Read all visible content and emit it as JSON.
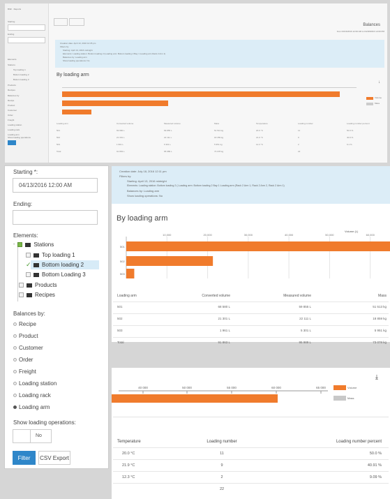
{
  "top": {
    "app_title": "ВЭК · Reports",
    "starting_label": "Starting",
    "starting_value": "04/13/2016 12:00 AM",
    "ending_label": "Ending",
    "back_label": "‹ Back",
    "report_title": "Balances",
    "report_subtitle": "from 04/13/2016 12:00 AM to 04/18/2016 12:00 PM",
    "info": {
      "line1": "Creation date: April 13, 2016 12:35 pm",
      "line2": "Filters by:",
      "items": [
        "Starting: April 13, 2016 midnight",
        "Elements: Loading station: Bottom loading 2 (Loading arm: Bottom loading 2 Bay 1 Loading arm Rack 2 Arm 1)",
        "Balances by: Loading arm",
        "Show loading operations: No"
      ]
    },
    "chart_title": "By loading arm",
    "legend": [
      "Volume",
      "Mass"
    ],
    "table_headers": [
      "Loading arm",
      "Converted volume",
      "Measured volume",
      "Mass",
      "Temperature",
      "Loading number",
      "Loading number percent"
    ],
    "table_rows": [
      [
        "501",
        "69 982 L",
        "69 855 L",
        "51 513 kg",
        "20.0 °C",
        "11",
        "50.0 %"
      ],
      [
        "502",
        "21 301 L",
        "22 111 L",
        "18 359 kg",
        "21.9 °C",
        "9",
        "40.9 %"
      ],
      [
        "503",
        "1 961 L",
        "6 301 L",
        "5 951 kg",
        "12.3 °C",
        "2",
        "9.1 %"
      ],
      [
        "Total",
        "91 863 L",
        "95 989 L",
        "73 078 kg",
        "",
        "22",
        ""
      ]
    ],
    "sidebar": [
      "Starting",
      "Ending",
      "Elements",
      "Stations",
      "Top loading 1",
      "Bottom loading 2",
      "Bottom loading 3",
      "Products",
      "Recipes",
      "Balances by",
      "Recipe",
      "Product",
      "Customer",
      "Order",
      "Freight",
      "Loading station",
      "Loading rack",
      "Loading arm",
      "Show loading operations",
      "No",
      "Filter",
      "CSV Export"
    ]
  },
  "filters": {
    "starting_label": "Starting *:",
    "starting_value": "04/13/2016 12:00 AM",
    "ending_label": "Ending:",
    "ending_value": "",
    "elements_label": "Elements:",
    "tree": [
      {
        "label": "Stations",
        "level": 0,
        "checked": true
      },
      {
        "label": "Top loading 1",
        "level": 1,
        "checked": false
      },
      {
        "label": "Bottom loading 2",
        "level": 1,
        "checked": true,
        "selected": true
      },
      {
        "label": "Bottom Loading 3",
        "level": 1,
        "checked": false
      },
      {
        "label": "Products",
        "level": 0,
        "checked": false
      },
      {
        "label": "Recipes",
        "level": 0,
        "checked": false
      }
    ],
    "balances_label": "Balances by:",
    "balances_options": [
      "Recipe",
      "Product",
      "Customer",
      "Order",
      "Freight",
      "Loading station",
      "Loading rack",
      "Loading arm"
    ],
    "balances_selected": "Loading arm",
    "show_ops_label": "Show loading operations:",
    "show_ops_value": "No",
    "filter_button": "Filter",
    "csv_button": "CSV Export"
  },
  "report": {
    "info_line1": "Creation date: July 18, 2016 12:11 pm",
    "info_line2": "Filters by:",
    "info_items": [
      "Starting: April 13, 2016 midnight",
      "Elements: Loading station: Bottom loading 2 ( Loading arm: Bottom loading 2 Bay 1 Loading arm (Rack 2 Arm 1, Rack 2 Arm 2, Rack 2 Arm 1)",
      "Balances by: Loading arm",
      "Show loading operations: No"
    ],
    "chart_title": "By loading arm",
    "axis_title": "Volume (L)",
    "ticks": [
      "10,000",
      "20,000",
      "30,000",
      "40,000",
      "50,000",
      "60,000"
    ],
    "bar_labels": [
      "501",
      "502",
      "503"
    ],
    "table1_headers": [
      "Loading arm",
      "Converted volume",
      "Measured volume",
      "Mass"
    ],
    "table1_rows": [
      [
        "501",
        "68 580 L",
        "59 855 L",
        "51 513 kg"
      ],
      [
        "502",
        "21 301 L",
        "22 111 L",
        "18 859 kg"
      ],
      [
        "503",
        "1 961 L",
        "5 301 L",
        "5 951 kg"
      ],
      [
        "Total",
        "91 863 L",
        "95 989 L",
        "73 078 kg"
      ]
    ],
    "chart2_ticks": [
      "40 000",
      "50 000",
      "55 000",
      "60 000",
      "65 000"
    ],
    "legend": [
      "Volume",
      "Mass"
    ],
    "table2_headers": [
      "Temperature",
      "Loading number",
      "Loading number percent"
    ],
    "table2_rows": [
      [
        "20.0 °C",
        "11",
        "50.0 %"
      ],
      [
        "21.9 °C",
        "9",
        "40.91 %"
      ],
      [
        "12.3 °C",
        "2",
        "9.09 %"
      ]
    ],
    "table2_total": "22"
  },
  "chart_data": {
    "type": "bar",
    "categories": [
      "501",
      "502",
      "503"
    ],
    "series": [
      {
        "name": "Volume",
        "values": [
          68580,
          21301,
          1961
        ]
      }
    ],
    "xlabel": "Volume (L)",
    "ylabel": "",
    "xlim": [
      0,
      70000
    ],
    "orientation": "horizontal"
  },
  "colors": {
    "accent": "#f07b2c",
    "info_bg": "#dcedf7",
    "filter_btn": "#2e86c9"
  }
}
